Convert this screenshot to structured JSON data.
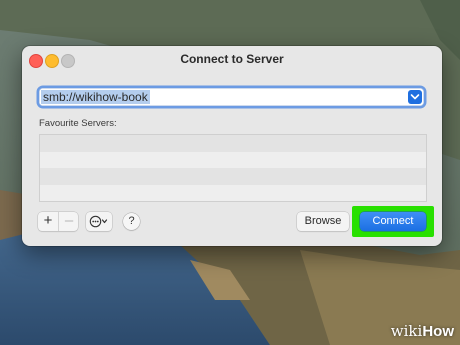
{
  "window": {
    "title": "Connect to Server"
  },
  "address": {
    "value": "smb://wikihow-book"
  },
  "favourites": {
    "label": "Favourite Servers:",
    "items": []
  },
  "toolbar": {
    "add_label": "+",
    "remove_label": "–",
    "help_label": "?",
    "browse_label": "Browse",
    "connect_label": "Connect"
  },
  "colors": {
    "accent": "#1f6fe0",
    "highlight": "#28e000"
  },
  "icons": {
    "more_options": "ellipsis-circle-icon",
    "dropdown": "chevron-down-icon"
  },
  "watermark": {
    "prefix": "wiki",
    "suffix": "How"
  }
}
